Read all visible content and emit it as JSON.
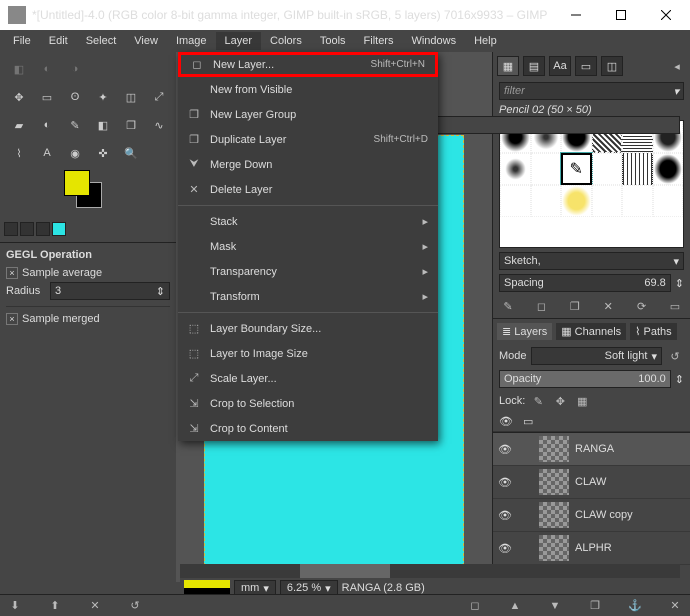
{
  "title": "*[Untitled]-4.0 (RGB color 8-bit gamma integer, GIMP built-in sRGB, 5 layers) 7016x9933 – GIMP",
  "menubar": [
    "File",
    "Edit",
    "Select",
    "View",
    "Image",
    "Layer",
    "Colors",
    "Tools",
    "Filters",
    "Windows",
    "Help"
  ],
  "active_menu_index": 5,
  "dropdown": [
    {
      "icon": "◻",
      "label": "New Layer...",
      "shortcut": "Shift+Ctrl+N",
      "hl": true
    },
    {
      "icon": "",
      "label": "New from Visible",
      "shortcut": ""
    },
    {
      "icon": "❐",
      "label": "New Layer Group",
      "shortcut": ""
    },
    {
      "icon": "❐",
      "label": "Duplicate Layer",
      "shortcut": "Shift+Ctrl+D"
    },
    {
      "icon": "⮟",
      "label": "Merge Down",
      "shortcut": ""
    },
    {
      "icon": "✕",
      "label": "Delete Layer",
      "shortcut": ""
    },
    {
      "sep": true
    },
    {
      "icon": "",
      "label": "Stack",
      "sub": true
    },
    {
      "icon": "",
      "label": "Mask",
      "sub": true
    },
    {
      "icon": "",
      "label": "Transparency",
      "sub": true
    },
    {
      "icon": "",
      "label": "Transform",
      "sub": true
    },
    {
      "sep": true
    },
    {
      "icon": "⬚",
      "label": "Layer Boundary Size...",
      "shortcut": ""
    },
    {
      "icon": "⬚",
      "label": "Layer to Image Size",
      "shortcut": ""
    },
    {
      "icon": "⤢",
      "label": "Scale Layer...",
      "shortcut": ""
    },
    {
      "icon": "⇲",
      "label": "Crop to Selection",
      "shortcut": ""
    },
    {
      "icon": "⇲",
      "label": "Crop to Content",
      "shortcut": ""
    }
  ],
  "tooloptions": {
    "header": "GEGL Operation",
    "opt1": "Sample average",
    "radius_label": "Radius",
    "radius_value": "3",
    "opt2": "Sample merged"
  },
  "right": {
    "filter_placeholder": "filter",
    "brush_label": "Pencil 02 (50 × 50)",
    "sketch_label": "Sketch,",
    "spacing_label": "Spacing",
    "spacing_value": "69.8",
    "tabs": {
      "layers": "Layers",
      "channels": "Channels",
      "paths": "Paths"
    },
    "mode_label": "Mode",
    "mode_value": "Soft light",
    "opacity_label": "Opacity",
    "opacity_value": "100.0",
    "lock_label": "Lock:"
  },
  "layers": [
    {
      "name": "RANGA",
      "sel": true
    },
    {
      "name": "CLAW"
    },
    {
      "name": "CLAW copy"
    },
    {
      "name": "ALPHR"
    },
    {
      "name": "",
      "cyan": true
    }
  ],
  "status": {
    "unit": "mm",
    "zoom": "6.25 %",
    "file": "RANGA (2.8 GB)"
  }
}
